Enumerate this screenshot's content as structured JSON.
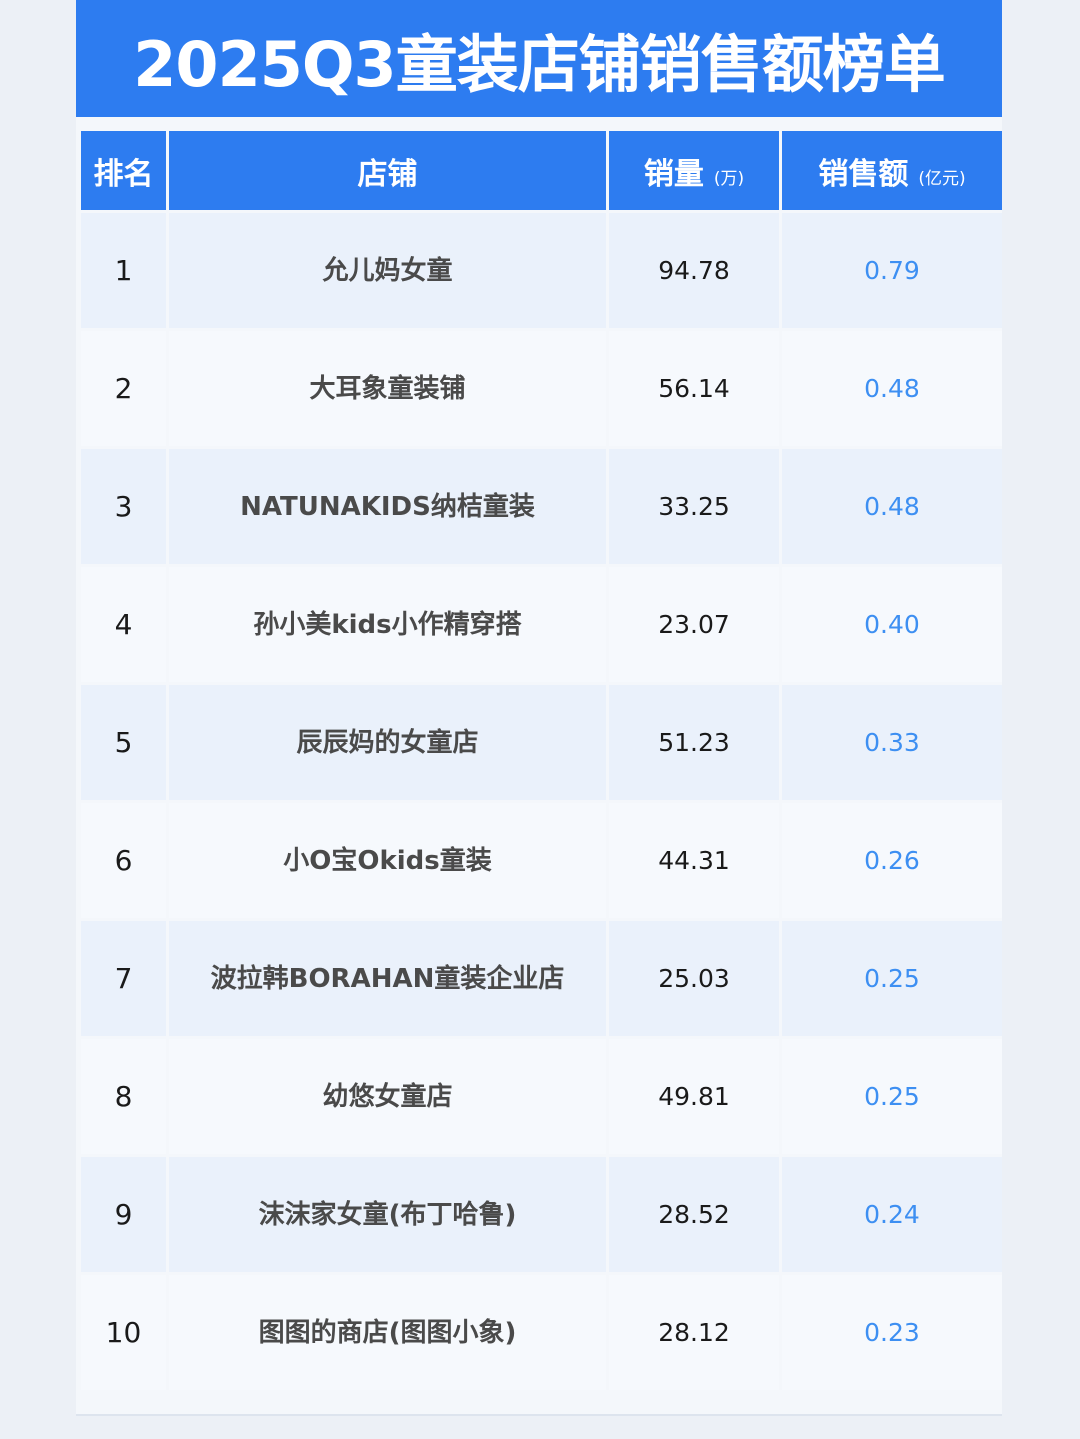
{
  "title": "2025Q3童装店铺销售额榜单",
  "colors": {
    "accent": "#2d7cf0",
    "amount_text": "#3d8ff2"
  },
  "chart_data": {
    "type": "table",
    "title": "2025Q3童装店铺销售额榜单",
    "columns": [
      {
        "label": "排名",
        "unit": ""
      },
      {
        "label": "店铺",
        "unit": ""
      },
      {
        "label": "销量",
        "unit": "(万)"
      },
      {
        "label": "销售额",
        "unit": "(亿元)"
      }
    ],
    "rows": [
      {
        "rank": "1",
        "store": "允儿妈女童",
        "qty": "94.78",
        "amount": "0.79"
      },
      {
        "rank": "2",
        "store": "大耳象童装铺",
        "qty": "56.14",
        "amount": "0.48"
      },
      {
        "rank": "3",
        "store": "NATUNAKIDS纳桔童装",
        "qty": "33.25",
        "amount": "0.48"
      },
      {
        "rank": "4",
        "store": "孙小美kids小作精穿搭",
        "qty": "23.07",
        "amount": "0.40"
      },
      {
        "rank": "5",
        "store": "辰辰妈的女童店",
        "qty": "51.23",
        "amount": "0.33"
      },
      {
        "rank": "6",
        "store": "小O宝Okids童装",
        "qty": "44.31",
        "amount": "0.26"
      },
      {
        "rank": "7",
        "store": "波拉韩BORAHAN童装企业店",
        "qty": "25.03",
        "amount": "0.25"
      },
      {
        "rank": "8",
        "store": "幼悠女童店",
        "qty": "49.81",
        "amount": "0.25"
      },
      {
        "rank": "9",
        "store": "沫沫家女童(布丁哈鲁)",
        "qty": "28.52",
        "amount": "0.24"
      },
      {
        "rank": "10",
        "store": "图图的商店(图图小象)",
        "qty": "28.12",
        "amount": "0.23"
      }
    ]
  }
}
